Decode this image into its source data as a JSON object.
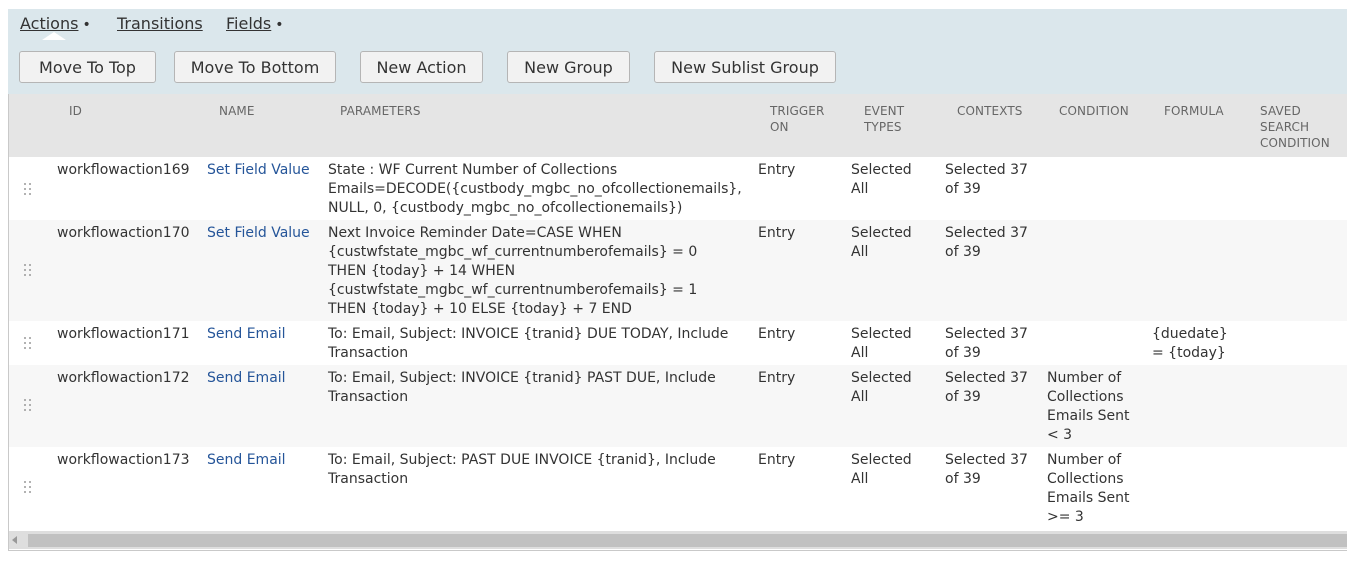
{
  "tabs": [
    {
      "label": "Actions",
      "dot": "•"
    },
    {
      "label": "Transitions",
      "dot": ""
    },
    {
      "label": "Fields",
      "dot": "•"
    }
  ],
  "buttons": {
    "move_to_top": "Move To Top",
    "move_to_bottom": "Move To Bottom",
    "new_action": "New Action",
    "new_group": "New Group",
    "new_sublist_group": "New Sublist Group"
  },
  "columns": {
    "id": "ID",
    "name": "NAME",
    "parameters": "PARAMETERS",
    "trigger_on": [
      "TRIGGER",
      "ON"
    ],
    "event_types": [
      "EVENT",
      "TYPES"
    ],
    "contexts": "CONTEXTS",
    "condition": "CONDITION",
    "formula": "FORMULA",
    "saved_search_condition": [
      "SAVED",
      "SEARCH",
      "CONDITION"
    ]
  },
  "rows": [
    {
      "id": "workflowaction169",
      "name": "Set Field Value",
      "parameters": [
        "State : WF Current Number of Collections",
        "Emails=DECODE({custbody_mgbc_no_ofcollectionemails},",
        "NULL, 0, {custbody_mgbc_no_ofcollectionemails})"
      ],
      "trigger_on": "Entry",
      "event_types": [
        "Selected",
        "All"
      ],
      "contexts": [
        "Selected 37",
        "of 39"
      ],
      "condition": [],
      "formula": []
    },
    {
      "id": "workflowaction170",
      "name": "Set Field Value",
      "parameters": [
        "Next Invoice Reminder Date=CASE WHEN",
        "{custwfstate_mgbc_wf_currentnumberofemails} = 0",
        "THEN {today} + 14 WHEN",
        "{custwfstate_mgbc_wf_currentnumberofemails} = 1",
        "THEN {today} + 10 ELSE {today} + 7 END"
      ],
      "trigger_on": "Entry",
      "event_types": [
        "Selected",
        "All"
      ],
      "contexts": [
        "Selected 37",
        "of 39"
      ],
      "condition": [],
      "formula": []
    },
    {
      "id": "workflowaction171",
      "name": "Send Email",
      "parameters": [
        "To: Email, Subject: INVOICE {tranid} DUE TODAY, Include",
        "Transaction"
      ],
      "trigger_on": "Entry",
      "event_types": [
        "Selected",
        "All"
      ],
      "contexts": [
        "Selected 37",
        "of 39"
      ],
      "condition": [],
      "formula": [
        "{duedate}",
        "= {today}"
      ]
    },
    {
      "id": "workflowaction172",
      "name": "Send Email",
      "parameters": [
        "To: Email, Subject: INVOICE {tranid} PAST DUE, Include",
        "Transaction"
      ],
      "trigger_on": "Entry",
      "event_types": [
        "Selected",
        "All"
      ],
      "contexts": [
        "Selected 37",
        "of 39"
      ],
      "condition": [
        "Number of",
        "Collections",
        "Emails Sent",
        "< 3"
      ],
      "formula": []
    },
    {
      "id": "workflowaction173",
      "name": "Send Email",
      "parameters": [
        "To: Email, Subject: PAST DUE INVOICE {tranid}, Include",
        "Transaction"
      ],
      "trigger_on": "Entry",
      "event_types": [
        "Selected",
        "All"
      ],
      "contexts": [
        "Selected 37",
        "of 39"
      ],
      "condition": [
        "Number of",
        "Collections",
        "Emails Sent",
        ">= 3"
      ],
      "formula": []
    }
  ],
  "icons": {
    "drag_handle": "drag-handle-icon",
    "scroll_left": "scroll-left-arrow-icon"
  },
  "colors": {
    "toolbar_bg": "#dbe7ec",
    "header_bg": "#e5e5e5",
    "link": "#255599"
  }
}
